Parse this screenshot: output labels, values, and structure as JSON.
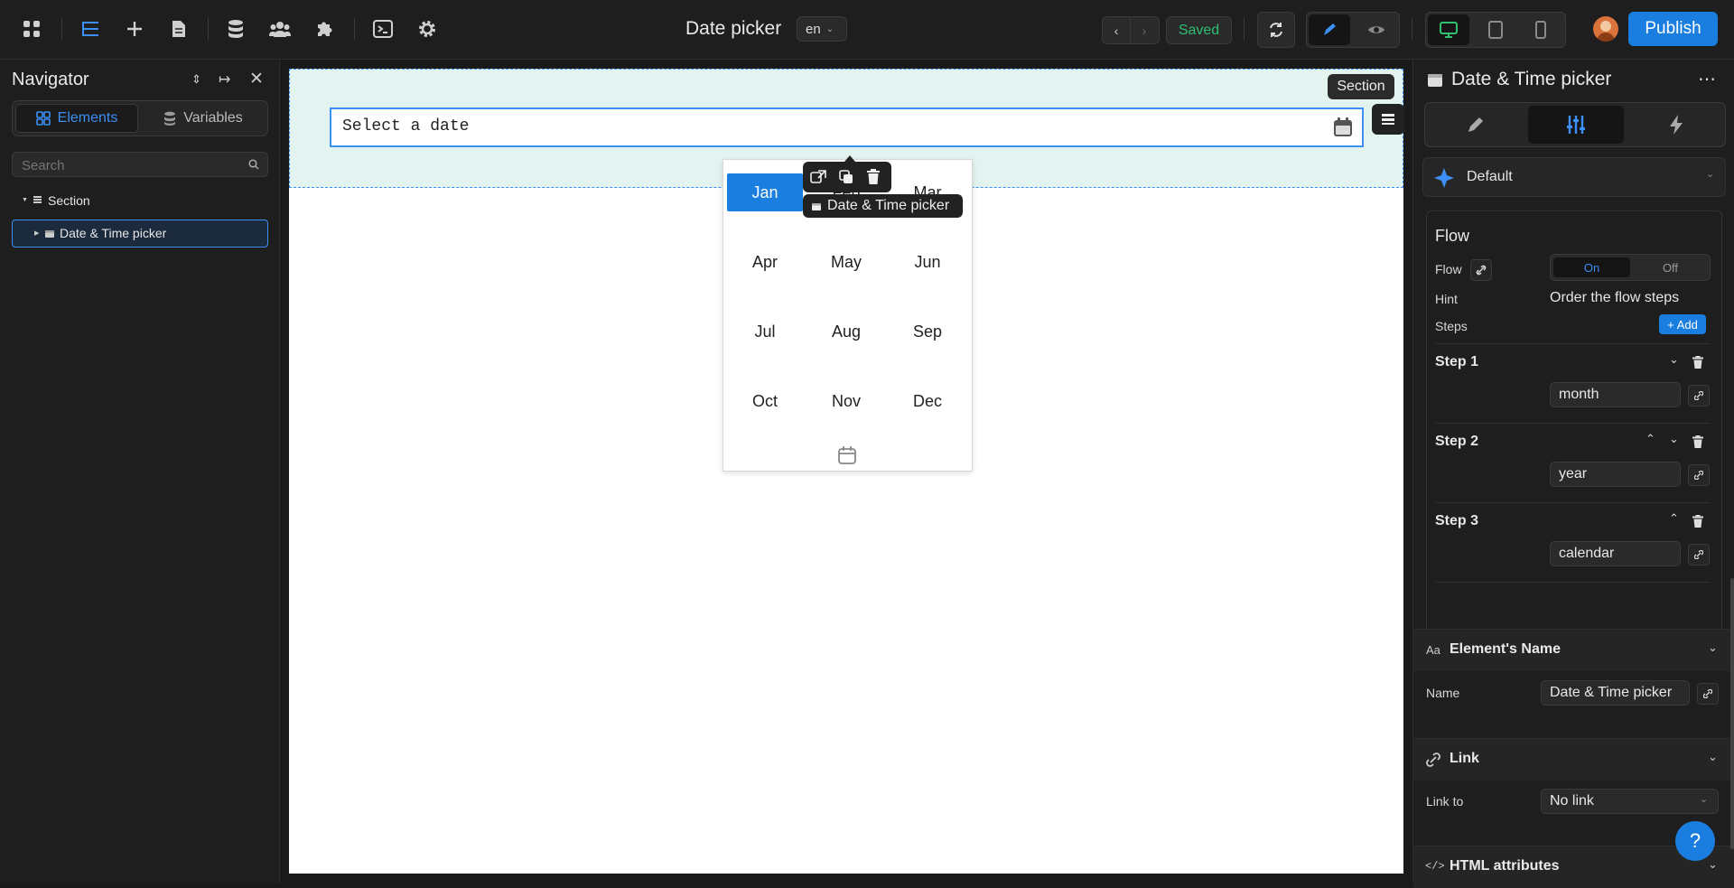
{
  "topbar": {
    "page_title": "Date picker",
    "lang": "en",
    "saved_label": "Saved",
    "publish_label": "Publish"
  },
  "navigator": {
    "title": "Navigator",
    "tabs": {
      "elements": "Elements",
      "variables": "Variables"
    },
    "search_placeholder": "Search",
    "tree": {
      "section": "Section",
      "picker": "Date & Time picker"
    }
  },
  "canvas": {
    "section_tag": "Section",
    "input_placeholder": "Select a date",
    "element_tag": "Date & Time picker",
    "months": [
      "Jan",
      "Feb",
      "Mar",
      "Apr",
      "May",
      "Jun",
      "Jul",
      "Aug",
      "Sep",
      "Oct",
      "Nov",
      "Dec"
    ],
    "selected_month": "Jan"
  },
  "inspector": {
    "title": "Date & Time picker",
    "preset": "Default",
    "flow": {
      "heading": "Flow",
      "flow_label": "Flow",
      "toggle_on": "On",
      "toggle_off": "Off",
      "hint_label": "Hint",
      "hint_value": "Order the flow steps",
      "steps_label": "Steps",
      "add_label": "Add",
      "steps": [
        {
          "label": "Step 1",
          "value": "month"
        },
        {
          "label": "Step 2",
          "value": "year"
        },
        {
          "label": "Step 3",
          "value": "calendar"
        }
      ]
    },
    "element_name": {
      "heading": "Element's Name",
      "name_label": "Name",
      "name_value": "Date & Time picker"
    },
    "link": {
      "heading": "Link",
      "link_to_label": "Link to",
      "link_to_value": "No link"
    },
    "html_attrs": {
      "heading": "HTML attributes"
    },
    "help_label": "?"
  },
  "colors": {
    "accent": "#1a7ee0",
    "saved_green": "#2fbf71",
    "section_bg": "#e3f3ef"
  }
}
